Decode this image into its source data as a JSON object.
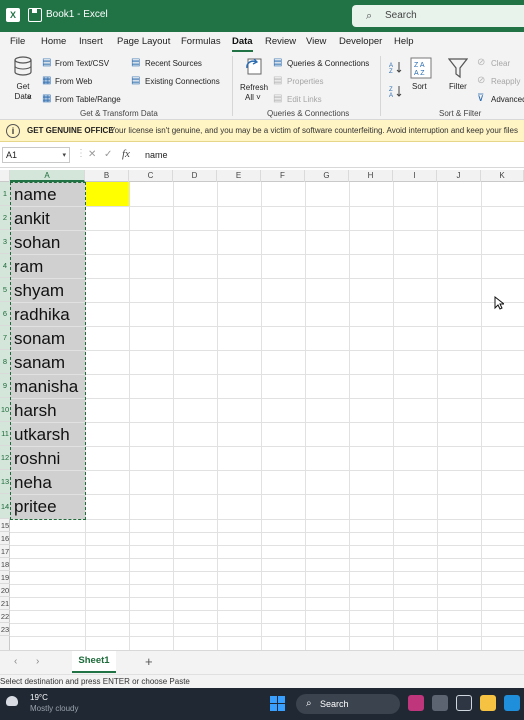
{
  "titlebar": {
    "app_icon": "X",
    "title": "Book1 - Excel",
    "search_placeholder": "Search"
  },
  "menu": {
    "tabs": [
      {
        "label": "File"
      },
      {
        "label": "Home"
      },
      {
        "label": "Insert"
      },
      {
        "label": "Page Layout"
      },
      {
        "label": "Formulas"
      },
      {
        "label": "Data",
        "active": true
      },
      {
        "label": "Review"
      },
      {
        "label": "View"
      },
      {
        "label": "Developer"
      },
      {
        "label": "Help"
      }
    ]
  },
  "ribbon": {
    "get_data": "Get Data",
    "get_data_arrow": "˅",
    "from_text_csv": "From Text/CSV",
    "from_web": "From Web",
    "from_table_range": "From Table/Range",
    "recent_sources": "Recent Sources",
    "existing_connections": "Existing Connections",
    "group_get_transform": "Get & Transform Data",
    "refresh_all_line1": "Refresh",
    "refresh_all_line2": "All ˅",
    "queries_connections": "Queries & Connections",
    "properties": "Properties",
    "edit_links": "Edit Links",
    "group_queries": "Queries & Connections",
    "sort_label": "Sort",
    "filter_label": "Filter",
    "clear": "Clear",
    "reapply": "Reapply",
    "advanced": "Advanced",
    "group_sort_filter": "Sort & Filter"
  },
  "infobar": {
    "title": "GET GENUINE OFFICE",
    "message": "Your license isn't genuine, and you may be a victim of software counterfeiting. Avoid interruption and keep your files"
  },
  "formula_bar": {
    "name_box": "A1",
    "fx": "fx",
    "cancel": "✕",
    "enter": "✓",
    "formula": "name"
  },
  "columns": [
    "A",
    "B",
    "C",
    "D",
    "E",
    "F",
    "G",
    "H",
    "I",
    "J",
    "K"
  ],
  "rows": [
    "1",
    "2",
    "3",
    "4",
    "5",
    "6",
    "7",
    "8",
    "9",
    "10",
    "11",
    "12",
    "13",
    "14",
    "15",
    "16",
    "17",
    "18",
    "19",
    "20",
    "21",
    "22",
    "23"
  ],
  "cells": {
    "A": [
      "name",
      "ankit",
      "sohan",
      "ram",
      "shyam",
      "radhika",
      "sonam",
      "sanam",
      "manisha",
      "harsh",
      "utkarsh",
      "roshni",
      "neha",
      "pritee"
    ]
  },
  "sheets": {
    "nav_prev": "‹",
    "nav_next": "›",
    "active": "Sheet1",
    "add": "+"
  },
  "status": {
    "message": "Select destination and press ENTER or choose Paste"
  },
  "taskbar": {
    "temperature": "19°C",
    "weather": "Mostly cloudy",
    "search": "Search"
  },
  "colors": {
    "excel_green": "#217346",
    "selection_gray": "#d0d0d0",
    "highlight_yellow": "#ffff00",
    "info_bar": "#fff4c4"
  }
}
